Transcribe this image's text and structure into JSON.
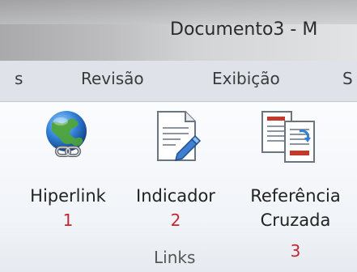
{
  "window": {
    "title": "Documento3 - M"
  },
  "tabs": {
    "partial_left": "s",
    "revisao": "Revisão",
    "exibicao": "Exibição",
    "partial_right": "S"
  },
  "ribbon": {
    "group_label": "Links",
    "commands": [
      {
        "label": "Hiperlink",
        "number": "1",
        "icon": "hyperlink-globe-icon"
      },
      {
        "label": "Indicador",
        "number": "2",
        "icon": "bookmark-icon"
      },
      {
        "label": "Referência",
        "label2": "Cruzada",
        "number": "3",
        "icon": "cross-reference-icon"
      }
    ]
  },
  "colors": {
    "annotation_red": "#c4262e",
    "ribbon_bg": "#f4f6f9"
  }
}
